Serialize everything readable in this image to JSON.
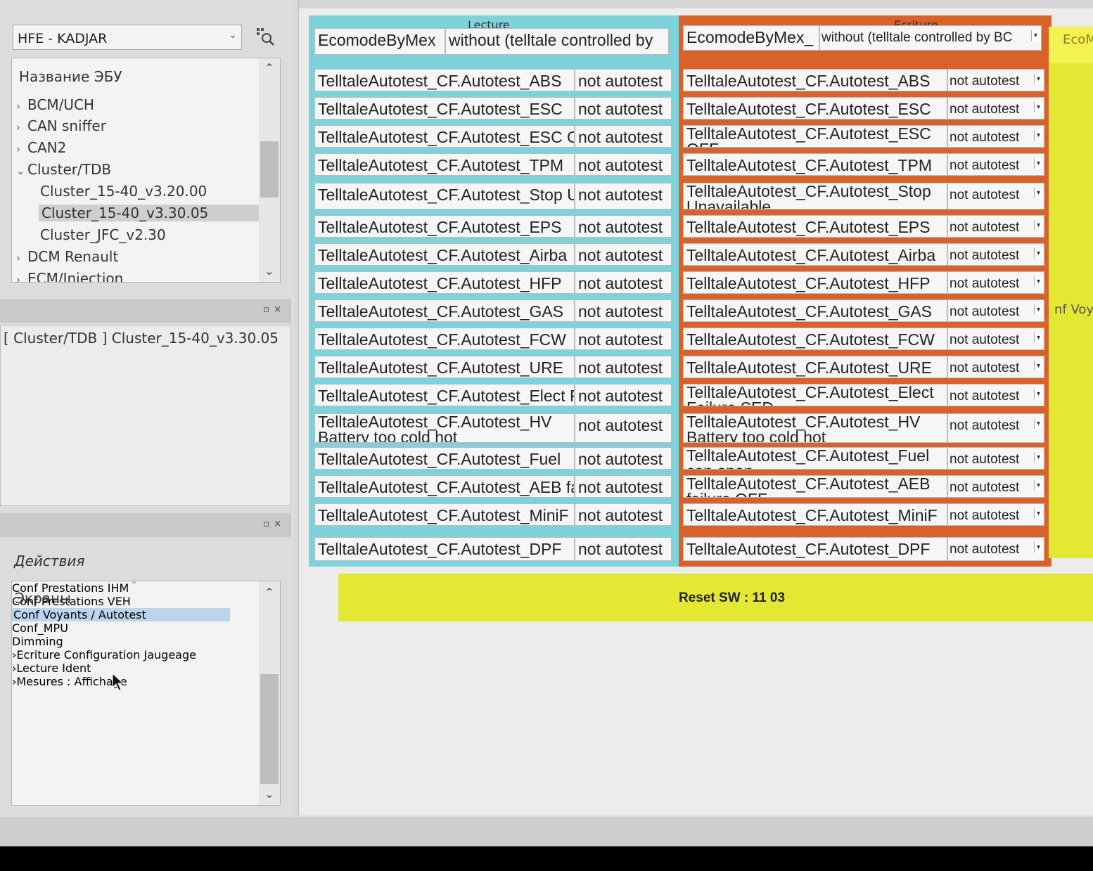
{
  "ecu_selector": {
    "value": "HFE - KADJAR"
  },
  "ecu_tree": {
    "header": "Название ЭБУ",
    "items": [
      {
        "label": "BCM/UCH",
        "chevron": "›"
      },
      {
        "label": "CAN sniffer",
        "chevron": "›"
      },
      {
        "label": "CAN2",
        "chevron": "›"
      },
      {
        "label": "Cluster/TDB",
        "chevron": "⌄"
      },
      {
        "label": "Cluster_15-40_v3.20.00",
        "chevron": ""
      },
      {
        "label": "Cluster_15-40_v3.30.05",
        "chevron": ""
      },
      {
        "label": "Cluster_JFC_v2.30",
        "chevron": ""
      },
      {
        "label": "DCM Renault",
        "chevron": "›"
      },
      {
        "label": "ECM/Injection",
        "chevron": "›"
      }
    ]
  },
  "selected_path": "[ Cluster/TDB ] Cluster_15-40_v3.30.05",
  "actions": {
    "title": "Действия",
    "header": "Экраны",
    "items": [
      {
        "label": "Conf Prestations IHM",
        "chevron": ""
      },
      {
        "label": "Conf Prestations VEH",
        "chevron": ""
      },
      {
        "label": "Conf Voyants / Autotest",
        "chevron": ""
      },
      {
        "label": "Conf_MPU",
        "chevron": ""
      },
      {
        "label": "Dimming",
        "chevron": ""
      },
      {
        "label": "Ecriture Configuration Jaugeage",
        "chevron": "›"
      },
      {
        "label": "Lecture Ident",
        "chevron": "›"
      },
      {
        "label": "Mesures : Affichage",
        "chevron": "›"
      }
    ]
  },
  "lecture": {
    "title": "Lecture",
    "ecomode_label": "EcomodeByMex",
    "ecomode_value": "without (telltale controlled by",
    "rows": [
      {
        "name": "TelltaleAutotest_CF.Autotest_ABS",
        "value": "not autotest"
      },
      {
        "name": "TelltaleAutotest_CF.Autotest_ESC",
        "value": "not autotest"
      },
      {
        "name": "TelltaleAutotest_CF.Autotest_ESC OFF",
        "value": "not autotest"
      },
      {
        "name": "TelltaleAutotest_CF.Autotest_TPM",
        "value": "not autotest"
      },
      {
        "name": "TelltaleAutotest_CF.Autotest_Stop Unavailable",
        "value": "not autotest"
      },
      {
        "name": "TelltaleAutotest_CF.Autotest_EPS",
        "value": "not autotest"
      },
      {
        "name": "TelltaleAutotest_CF.Autotest_Airba",
        "value": "not autotest"
      },
      {
        "name": "TelltaleAutotest_CF.Autotest_HFP",
        "value": "not autotest"
      },
      {
        "name": "TelltaleAutotest_CF.Autotest_GAS",
        "value": "not autotest"
      },
      {
        "name": "TelltaleAutotest_CF.Autotest_FCW",
        "value": "not autotest"
      },
      {
        "name": "TelltaleAutotest_CF.Autotest_URE",
        "value": "not autotest"
      },
      {
        "name": "TelltaleAutotest_CF.Autotest_Elect Failure SED",
        "value": "not autotest"
      },
      {
        "name": "TelltaleAutotest_CF.Autotest_HV Battery too cold hot",
        "value": "not autotest"
      },
      {
        "name": "TelltaleAutotest_CF.Autotest_Fuel",
        "value": "not autotest"
      },
      {
        "name": "TelltaleAutotest_CF.Autotest_AEB failure OFF",
        "value": "not autotest"
      },
      {
        "name": "TelltaleAutotest_CF.Autotest_MiniF",
        "value": "not autotest"
      },
      {
        "name": "TelltaleAutotest_CF.Autotest_DPF",
        "value": "not autotest"
      }
    ]
  },
  "ecriture": {
    "title": "Ecriture",
    "ecomode_label": "EcomodeByMex_",
    "ecomode_value": "without (telltale controlled by BC",
    "rows": [
      {
        "name": "TelltaleAutotest_CF.Autotest_ABS",
        "value": "not autotest"
      },
      {
        "name": "TelltaleAutotest_CF.Autotest_ESC",
        "value": "not autotest"
      },
      {
        "name": "TelltaleAutotest_CF.Autotest_ESC OFF",
        "value": "not autotest"
      },
      {
        "name": "TelltaleAutotest_CF.Autotest_TPM",
        "value": "not autotest"
      },
      {
        "name": "TelltaleAutotest_CF.Autotest_Stop Unavailable",
        "value": "not autotest"
      },
      {
        "name": "TelltaleAutotest_CF.Autotest_EPS",
        "value": "not autotest"
      },
      {
        "name": "TelltaleAutotest_CF.Autotest_Airba",
        "value": "not autotest"
      },
      {
        "name": "TelltaleAutotest_CF.Autotest_HFP",
        "value": "not autotest"
      },
      {
        "name": "TelltaleAutotest_CF.Autotest_GAS",
        "value": "not autotest"
      },
      {
        "name": "TelltaleAutotest_CF.Autotest_FCW",
        "value": "not autotest"
      },
      {
        "name": "TelltaleAutotest_CF.Autotest_URE",
        "value": "not autotest"
      },
      {
        "name": "TelltaleAutotest_CF.Autotest_Elect Failure SED",
        "value": "not autotest"
      },
      {
        "name": "TelltaleAutotest_CF.Autotest_HV Battery too cold hot",
        "value": "not autotest"
      },
      {
        "name": "TelltaleAutotest_CF.Autotest_Fuel can open",
        "value": "not autotest"
      },
      {
        "name": "TelltaleAutotest_CF.Autotest_AEB failure OFF",
        "value": "not autotest"
      },
      {
        "name": "TelltaleAutotest_CF.Autotest_MiniF",
        "value": "not autotest"
      },
      {
        "name": "TelltaleAutotest_CF.Autotest_DPF",
        "value": "not autotest"
      }
    ]
  },
  "yellow_panel": {
    "top_label": "EcoM",
    "side_label": "nf Voy"
  },
  "reset": {
    "label": "Reset SW : 11 03"
  },
  "colors": {
    "lecture": "#7dd3db",
    "ecriture": "#d9622a",
    "highlight": "#e3e932"
  }
}
